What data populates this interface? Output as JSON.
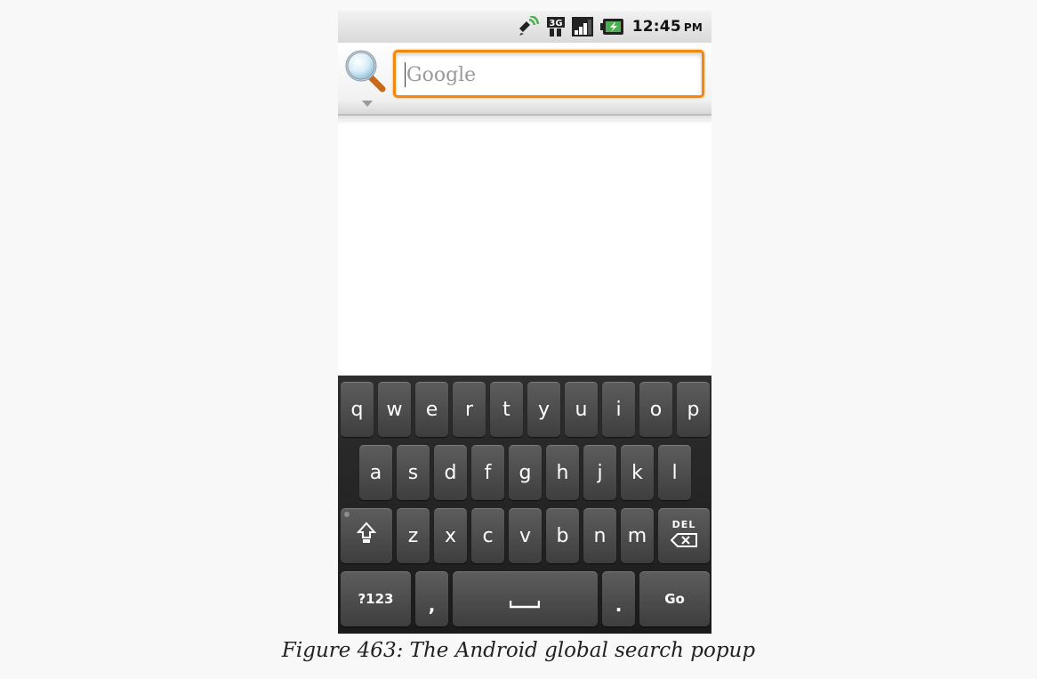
{
  "status_bar": {
    "time": "12:45",
    "ampm": "PM",
    "icons": [
      "gps-icon",
      "3g-icon",
      "signal-icon",
      "battery-charging-icon"
    ]
  },
  "search": {
    "placeholder": "Google",
    "value": "",
    "source_icon": "magnifier-icon"
  },
  "keyboard": {
    "row1": [
      "q",
      "w",
      "e",
      "r",
      "t",
      "y",
      "u",
      "i",
      "o",
      "p"
    ],
    "row2": [
      "a",
      "s",
      "d",
      "f",
      "g",
      "h",
      "j",
      "k",
      "l"
    ],
    "row3": [
      "z",
      "x",
      "c",
      "v",
      "b",
      "n",
      "m"
    ],
    "shift_icon": "shift-icon",
    "del_label": "DEL",
    "symbols_label": "?123",
    "comma_label": ",",
    "period_label": ".",
    "go_label": "Go",
    "space_icon": "spacebar-icon"
  },
  "caption": "Figure 463: The Android global search popup",
  "colors": {
    "focus_border": "#f2890f",
    "key_top": "#5d5d5d",
    "key_bottom": "#3e3e3e",
    "keyboard_bg": "#262626"
  }
}
